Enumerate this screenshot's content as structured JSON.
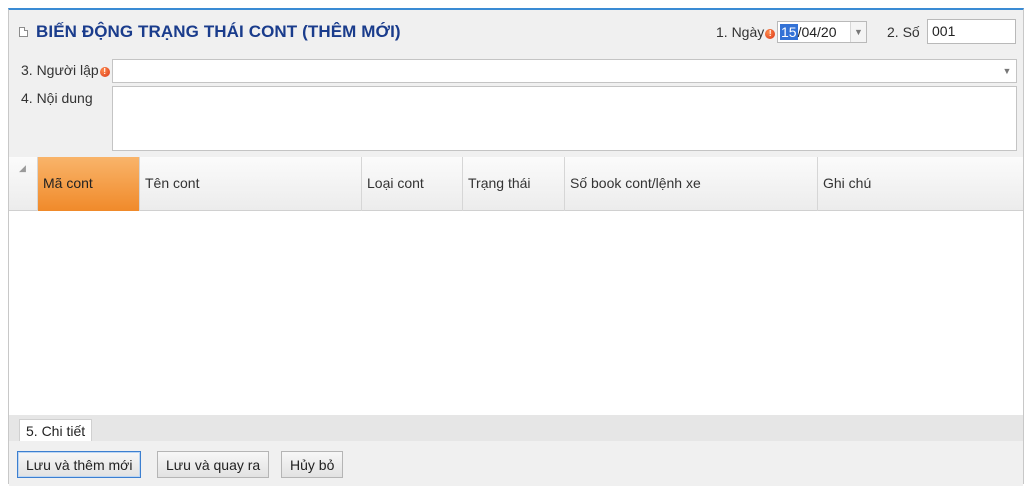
{
  "title": "BIẾN ĐỘNG TRẠNG THÁI CONT (THÊM MỚI)",
  "fields": {
    "ngay": {
      "label": "1. Ngày",
      "value_selected": "15",
      "value_rest": "/04/20"
    },
    "so": {
      "label": "2. Số",
      "value": "001"
    },
    "nguoi_lap": {
      "label": "3. Người lập",
      "value": ""
    },
    "noi_dung": {
      "label": "4. Nội dung",
      "value": ""
    }
  },
  "required_marker": "!",
  "grid": {
    "columns": [
      "Mã cont",
      "Tên cont",
      "Loại cont",
      "Trạng thái",
      "Số book cont/lệnh xe",
      "Ghi chú"
    ],
    "rows": []
  },
  "tab": {
    "label": "5. Chi tiết"
  },
  "buttons": {
    "save_new": "Lưu và thêm mới",
    "save_exit": "Lưu và quay ra",
    "cancel": "Hủy bỏ"
  },
  "icons": {
    "dropdown": "chevron-down-icon",
    "title": "document-icon",
    "required": "required-icon"
  }
}
